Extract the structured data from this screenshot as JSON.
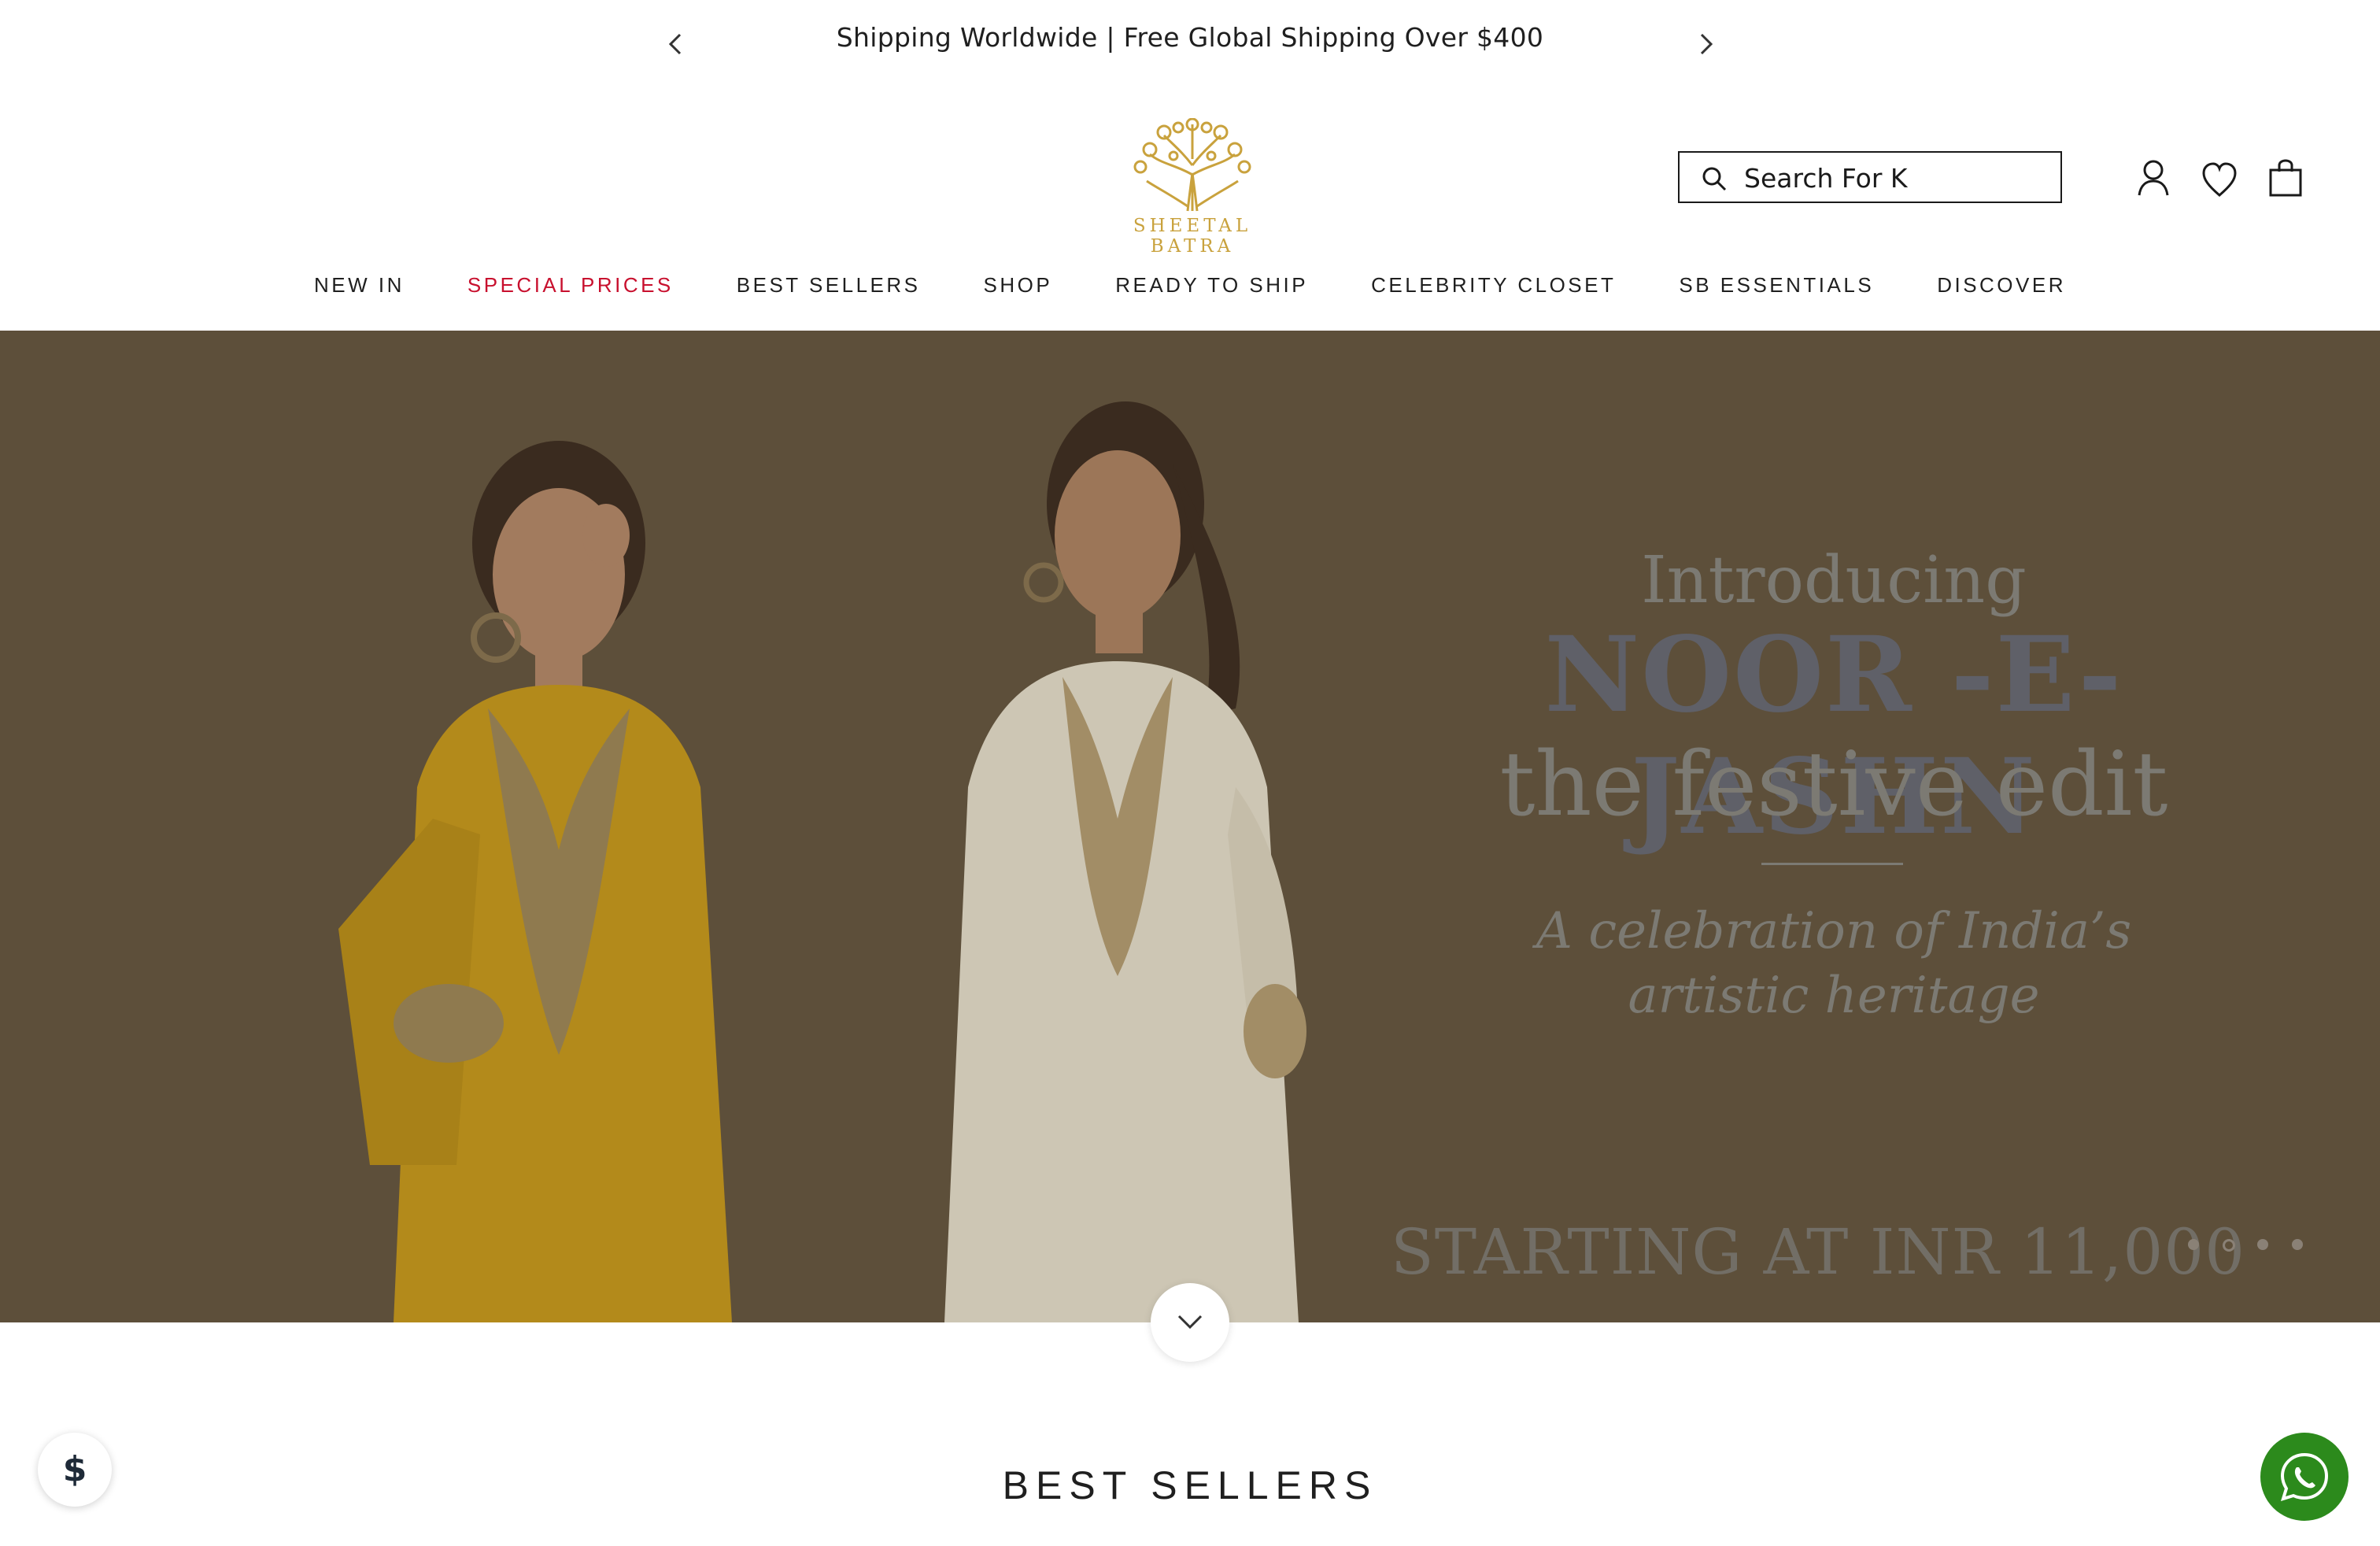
{
  "announcement": {
    "message": "Shipping Worldwide | Free Global Shipping Over $400"
  },
  "header": {
    "brand": "SHEETAL BATRA",
    "search": {
      "value": "Search For K",
      "placeholder": "Search For K"
    }
  },
  "nav": {
    "items": [
      {
        "label": "NEW IN"
      },
      {
        "label": "SPECIAL PRICES",
        "highlight": "#c8102e"
      },
      {
        "label": "BEST SELLERS"
      },
      {
        "label": "SHOP"
      },
      {
        "label": "READY TO SHIP"
      },
      {
        "label": "CELEBRITY CLOSET"
      },
      {
        "label": "SB ESSENTIALS"
      },
      {
        "label": "DISCOVER"
      }
    ]
  },
  "hero": {
    "intro": "Introducing",
    "collection": "NOOR -E-JASHN",
    "subtitle": "the festive edit",
    "tagline_line1": "A celebration of India’s",
    "tagline_line2": "artistic heritage",
    "price": "STARTING AT INR 11,000",
    "slides_total": 4,
    "active_slide": 2
  },
  "sections": {
    "best_sellers_title": "BEST SELLERS"
  },
  "floating": {
    "currency_symbol": "$"
  },
  "colors": {
    "accent_red": "#c8102e",
    "brand_gold": "#c9a23d",
    "hero_overlay": "#5d4f3a",
    "whatsapp_green": "#2c8a1c"
  }
}
